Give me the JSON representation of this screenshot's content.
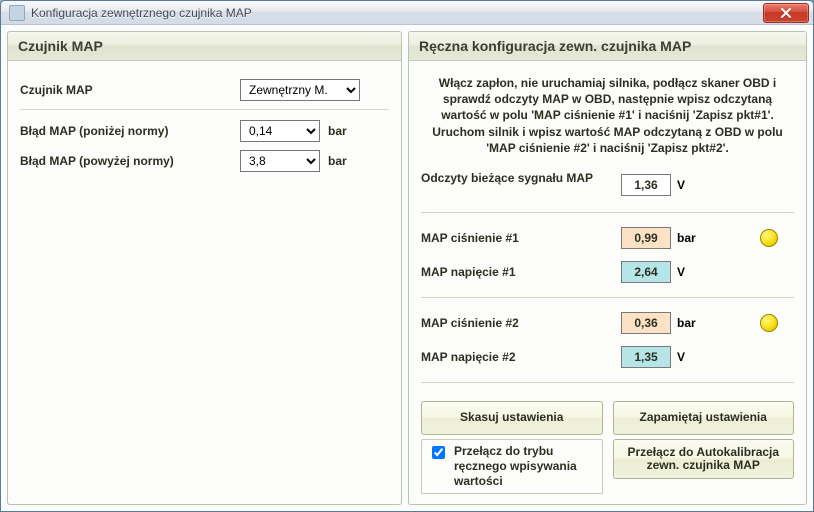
{
  "window": {
    "title": "Konfiguracja zewnętrznego czujnika MAP"
  },
  "left": {
    "header": "Czujnik MAP",
    "sensor_label": "Czujnik MAP",
    "sensor_value": "Zewnętrzny M.",
    "err_low_label": "Błąd MAP (poniżej normy)",
    "err_low_value": "0,14",
    "err_high_label": "Błąd MAP (powyżej normy)",
    "err_high_value": "3,8",
    "unit_bar": "bar"
  },
  "right": {
    "header": "Ręczna konfiguracja zewn. czujnika MAP",
    "instructions": "Włącz zapłon, nie uruchamiaj silnika, podłącz skaner OBD i sprawdź odczyty MAP w OBD, następnie wpisz odczytaną wartość w polu 'MAP ciśnienie #1' i naciśnij 'Zapisz pkt#1'. Uruchom silnik i wpisz wartość MAP odczytaną z OBD w polu 'MAP ciśnienie #2' i naciśnij 'Zapisz pkt#2'.",
    "live_label": "Odczyty bieżące sygnału MAP",
    "live_value": "1,36",
    "unit_v": "V",
    "unit_bar": "bar",
    "p1_pressure_label": "MAP ciśnienie #1",
    "p1_pressure_value": "0,99",
    "p1_voltage_label": "MAP napięcie #1",
    "p1_voltage_value": "2,64",
    "p2_pressure_label": "MAP ciśnienie #2",
    "p2_pressure_value": "0,36",
    "p2_voltage_label": "MAP napięcie #2",
    "p2_voltage_value": "1,35",
    "btn_reset": "Skasuj ustawienia",
    "btn_save": "Zapamiętaj ustawienia",
    "checkbox_label": "Przełącz do trybu ręcznego wpisywania wartości",
    "checkbox_checked": true,
    "btn_autocal": "Przełącz do Autokalibracja zewn. czujnika MAP"
  }
}
